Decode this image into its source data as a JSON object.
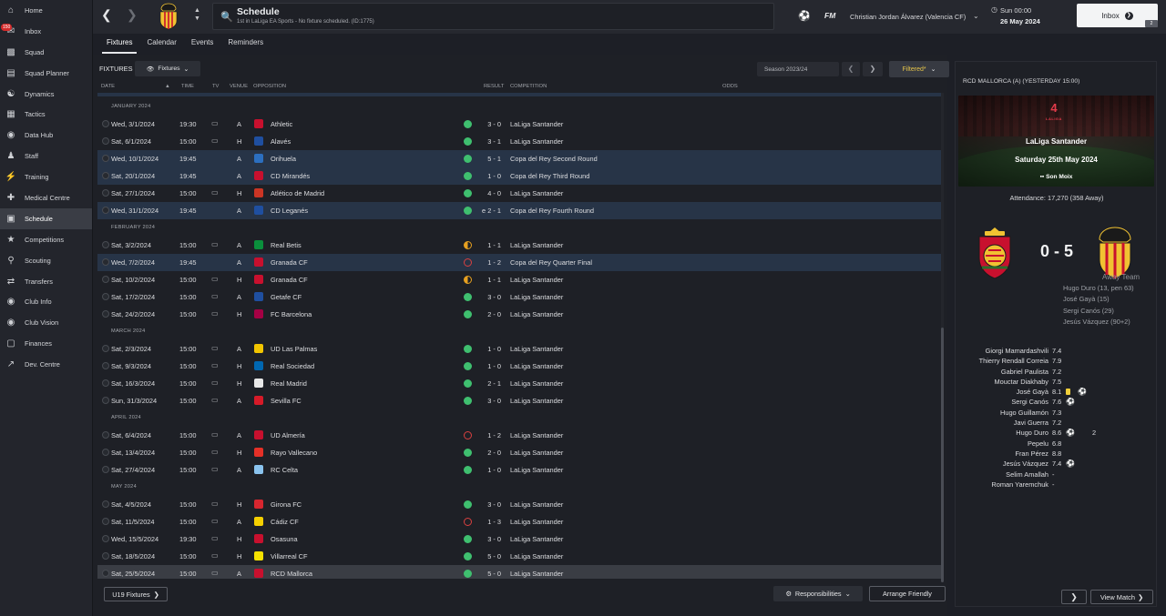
{
  "sidebar": {
    "items": [
      {
        "label": "Home",
        "icon": "house-icon"
      },
      {
        "label": "Inbox",
        "icon": "inbox-icon",
        "badge": "150"
      },
      {
        "label": "Squad",
        "icon": "shirt-icon"
      },
      {
        "label": "Squad Planner",
        "icon": "clipboard-icon"
      },
      {
        "label": "Dynamics",
        "icon": "dynamics-icon"
      },
      {
        "label": "Tactics",
        "icon": "tactics-board-icon"
      },
      {
        "label": "Data Hub",
        "icon": "data-hub-icon"
      },
      {
        "label": "Staff",
        "icon": "staff-icon"
      },
      {
        "label": "Training",
        "icon": "training-icon"
      },
      {
        "label": "Medical Centre",
        "icon": "medical-icon"
      },
      {
        "label": "Schedule",
        "icon": "calendar-icon"
      },
      {
        "label": "Competitions",
        "icon": "trophy-icon"
      },
      {
        "label": "Scouting",
        "icon": "binoculars-icon"
      },
      {
        "label": "Transfers",
        "icon": "transfers-icon"
      },
      {
        "label": "Club Info",
        "icon": "club-info-icon"
      },
      {
        "label": "Club Vision",
        "icon": "club-vision-icon"
      },
      {
        "label": "Finances",
        "icon": "finances-icon"
      },
      {
        "label": "Dev. Centre",
        "icon": "dev-centre-icon"
      }
    ],
    "active": "Schedule"
  },
  "header": {
    "title": "Schedule",
    "subtitle": "1st in LaLiga EA Sports - No fixture scheduled. (ID:1775)",
    "manager": "Christian Jordan Álvarez (Valencia CF)",
    "fm_logo": "FM",
    "time": "Sun 00:00",
    "date": "26 May 2024",
    "inbox_label": "Inbox",
    "corner_badge": "2"
  },
  "tabs": [
    "Fixtures",
    "Calendar",
    "Events",
    "Reminders"
  ],
  "fixtures": {
    "heading": "FIXTURES",
    "view_label": "Fixtures",
    "season": "Season 2023/24",
    "filter_label": "Filtered*",
    "columns": {
      "date": "DATE",
      "time": "TIME",
      "tv": "TV",
      "venue": "VENUE",
      "opposition": "OPPOSITION",
      "result": "RESULT",
      "competition": "COMPETITION",
      "odds": "ODDS"
    },
    "groups": [
      {
        "label": "JANUARY 2024",
        "rows": [
          {
            "date": "Wed, 3/1/2024",
            "time": "19:30",
            "tv": true,
            "venue": "A",
            "opp": "Athletic",
            "res": "3 - 0",
            "outcome": "win",
            "comp": "LaLiga Santander",
            "cup": false,
            "crest": "#c8102e"
          },
          {
            "date": "Sat, 6/1/2024",
            "time": "15:00",
            "tv": true,
            "venue": "H",
            "opp": "Alavés",
            "res": "3 - 1",
            "outcome": "win",
            "comp": "LaLiga Santander",
            "cup": false,
            "crest": "#1f4fa0"
          },
          {
            "date": "Wed, 10/1/2024",
            "time": "19:45",
            "tv": false,
            "venue": "A",
            "opp": "Orihuela",
            "res": "5 - 1",
            "outcome": "win",
            "comp": "Copa del Rey Second Round",
            "cup": true,
            "crest": "#2c6fbf"
          },
          {
            "date": "Sat, 20/1/2024",
            "time": "19:45",
            "tv": false,
            "venue": "A",
            "opp": "CD Mirandés",
            "res": "1 - 0",
            "outcome": "win",
            "comp": "Copa del Rey Third Round",
            "cup": true,
            "crest": "#c8102e"
          },
          {
            "date": "Sat, 27/1/2024",
            "time": "15:00",
            "tv": true,
            "venue": "H",
            "opp": "Atlético de Madrid",
            "res": "4 - 0",
            "outcome": "win",
            "comp": "LaLiga Santander",
            "cup": false,
            "crest": "#cb3524"
          },
          {
            "date": "Wed, 31/1/2024",
            "time": "19:45",
            "tv": false,
            "venue": "A",
            "opp": "CD Leganés",
            "res": "e 2 - 1",
            "outcome": "win",
            "comp": "Copa del Rey Fourth Round",
            "cup": true,
            "crest": "#1f4fa0"
          }
        ]
      },
      {
        "label": "FEBRUARY 2024",
        "rows": [
          {
            "date": "Sat, 3/2/2024",
            "time": "15:00",
            "tv": true,
            "venue": "A",
            "opp": "Real Betis",
            "res": "1 - 1",
            "outcome": "draw",
            "comp": "LaLiga Santander",
            "cup": false,
            "crest": "#0a8f3c"
          },
          {
            "date": "Wed, 7/2/2024",
            "time": "19:45",
            "tv": false,
            "venue": "A",
            "opp": "Granada CF",
            "res": "1 - 2",
            "outcome": "loss",
            "comp": "Copa del Rey Quarter Final",
            "cup": true,
            "crest": "#c8102e"
          },
          {
            "date": "Sat, 10/2/2024",
            "time": "15:00",
            "tv": true,
            "venue": "H",
            "opp": "Granada CF",
            "res": "1 - 1",
            "outcome": "draw",
            "comp": "LaLiga Santander",
            "cup": false,
            "crest": "#c8102e"
          },
          {
            "date": "Sat, 17/2/2024",
            "time": "15:00",
            "tv": true,
            "venue": "A",
            "opp": "Getafe CF",
            "res": "3 - 0",
            "outcome": "win",
            "comp": "LaLiga Santander",
            "cup": false,
            "crest": "#1f4fa0"
          },
          {
            "date": "Sat, 24/2/2024",
            "time": "15:00",
            "tv": true,
            "venue": "H",
            "opp": "FC Barcelona",
            "res": "2 - 0",
            "outcome": "win",
            "comp": "LaLiga Santander",
            "cup": false,
            "crest": "#a50044"
          }
        ]
      },
      {
        "label": "MARCH 2024",
        "rows": [
          {
            "date": "Sat, 2/3/2024",
            "time": "15:00",
            "tv": true,
            "venue": "A",
            "opp": "UD Las Palmas",
            "res": "1 - 0",
            "outcome": "win",
            "comp": "LaLiga Santander",
            "cup": false,
            "crest": "#f2c500"
          },
          {
            "date": "Sat, 9/3/2024",
            "time": "15:00",
            "tv": true,
            "venue": "H",
            "opp": "Real Sociedad",
            "res": "1 - 0",
            "outcome": "win",
            "comp": "LaLiga Santander",
            "cup": false,
            "crest": "#0067b1"
          },
          {
            "date": "Sat, 16/3/2024",
            "time": "15:00",
            "tv": true,
            "venue": "H",
            "opp": "Real Madrid",
            "res": "2 - 1",
            "outcome": "win",
            "comp": "LaLiga Santander",
            "cup": false,
            "crest": "#e8e8e8"
          },
          {
            "date": "Sun, 31/3/2024",
            "time": "15:00",
            "tv": true,
            "venue": "A",
            "opp": "Sevilla FC",
            "res": "3 - 0",
            "outcome": "win",
            "comp": "LaLiga Santander",
            "cup": false,
            "crest": "#d71a28"
          }
        ]
      },
      {
        "label": "APRIL 2024",
        "rows": [
          {
            "date": "Sat, 6/4/2024",
            "time": "15:00",
            "tv": true,
            "venue": "A",
            "opp": "UD Almería",
            "res": "1 - 2",
            "outcome": "loss",
            "comp": "LaLiga Santander",
            "cup": false,
            "crest": "#c8102e"
          },
          {
            "date": "Sat, 13/4/2024",
            "time": "15:00",
            "tv": true,
            "venue": "H",
            "opp": "Rayo Vallecano",
            "res": "2 - 0",
            "outcome": "win",
            "comp": "LaLiga Santander",
            "cup": false,
            "crest": "#e53027"
          },
          {
            "date": "Sat, 27/4/2024",
            "time": "15:00",
            "tv": true,
            "venue": "A",
            "opp": "RC Celta",
            "res": "1 - 0",
            "outcome": "win",
            "comp": "LaLiga Santander",
            "cup": false,
            "crest": "#8ac3ee"
          }
        ]
      },
      {
        "label": "MAY 2024",
        "rows": [
          {
            "date": "Sat, 4/5/2024",
            "time": "15:00",
            "tv": true,
            "venue": "H",
            "opp": "Girona FC",
            "res": "3 - 0",
            "outcome": "win",
            "comp": "LaLiga Santander",
            "cup": false,
            "crest": "#d7262f"
          },
          {
            "date": "Sat, 11/5/2024",
            "time": "15:00",
            "tv": true,
            "venue": "A",
            "opp": "Cádiz CF",
            "res": "1 - 3",
            "outcome": "loss",
            "comp": "LaLiga Santander",
            "cup": false,
            "crest": "#f5d000"
          },
          {
            "date": "Wed, 15/5/2024",
            "time": "19:30",
            "tv": true,
            "venue": "H",
            "opp": "Osasuna",
            "res": "3 - 0",
            "outcome": "win",
            "comp": "LaLiga Santander",
            "cup": false,
            "crest": "#c8102e"
          },
          {
            "date": "Sat, 18/5/2024",
            "time": "15:00",
            "tv": true,
            "venue": "H",
            "opp": "Villarreal CF",
            "res": "5 - 0",
            "outcome": "win",
            "comp": "LaLiga Santander",
            "cup": false,
            "crest": "#f5e100"
          },
          {
            "date": "Sat, 25/5/2024",
            "time": "15:00",
            "tv": true,
            "venue": "A",
            "opp": "RCD Mallorca",
            "res": "5 - 0",
            "outcome": "win",
            "comp": "LaLiga Santander",
            "cup": false,
            "crest": "#c8102e",
            "selected": true
          }
        ]
      }
    ],
    "u19_label": "U19 Fixtures",
    "responsibilities_label": "Responsibilities",
    "arrange_label": "Arrange Friendly"
  },
  "match_panel": {
    "title": "RCD MALLORCA (A) (YESTERDAY 15:00)",
    "competition": "LaLiga Santander",
    "match_date": "Saturday 25th May 2024",
    "venue": "Son Moix",
    "attendance": "Attendance: 17,270 (358 Away)",
    "score": "0 - 5",
    "away_team_label": "Away Team",
    "scorers": [
      "Hugo Duro (13, pen 63)",
      "José Gayà (15)",
      "Sergi Canós (29)",
      "Jesús Vázquez (90+2)"
    ],
    "ratings": [
      {
        "name": "Giorgi Mamardashvili",
        "rating": "7.4"
      },
      {
        "name": "Thierry Rendall Correia",
        "rating": "7.9"
      },
      {
        "name": "Gabriel Paulista",
        "rating": "7.2"
      },
      {
        "name": "Mouctar Diakhaby",
        "rating": "7.5"
      },
      {
        "name": "José Gayà",
        "rating": "8.1",
        "card": true,
        "goals": 1
      },
      {
        "name": "Sergi Canós",
        "rating": "7.6",
        "goals": 1
      },
      {
        "name": "Hugo Guillamón",
        "rating": "7.3"
      },
      {
        "name": "Javi Guerra",
        "rating": "7.2"
      },
      {
        "name": "Hugo Duro",
        "rating": "8.6",
        "goals": 1,
        "goal_count": "2"
      },
      {
        "name": "Pepelu",
        "rating": "6.8"
      },
      {
        "name": "Fran Pérez",
        "rating": "8.8"
      },
      {
        "name": "Jesús Vázquez",
        "rating": "7.4",
        "goals": 1
      },
      {
        "name": "Selim Amallah",
        "rating": "-"
      },
      {
        "name": "Roman Yaremchuk",
        "rating": "-"
      }
    ],
    "view_match_label": "View Match"
  },
  "colors": {
    "win": "#3fbf6f",
    "draw": "#e6a020",
    "loss": "#d94040",
    "cup_row": "#273447",
    "accent": "#e6c54a"
  }
}
